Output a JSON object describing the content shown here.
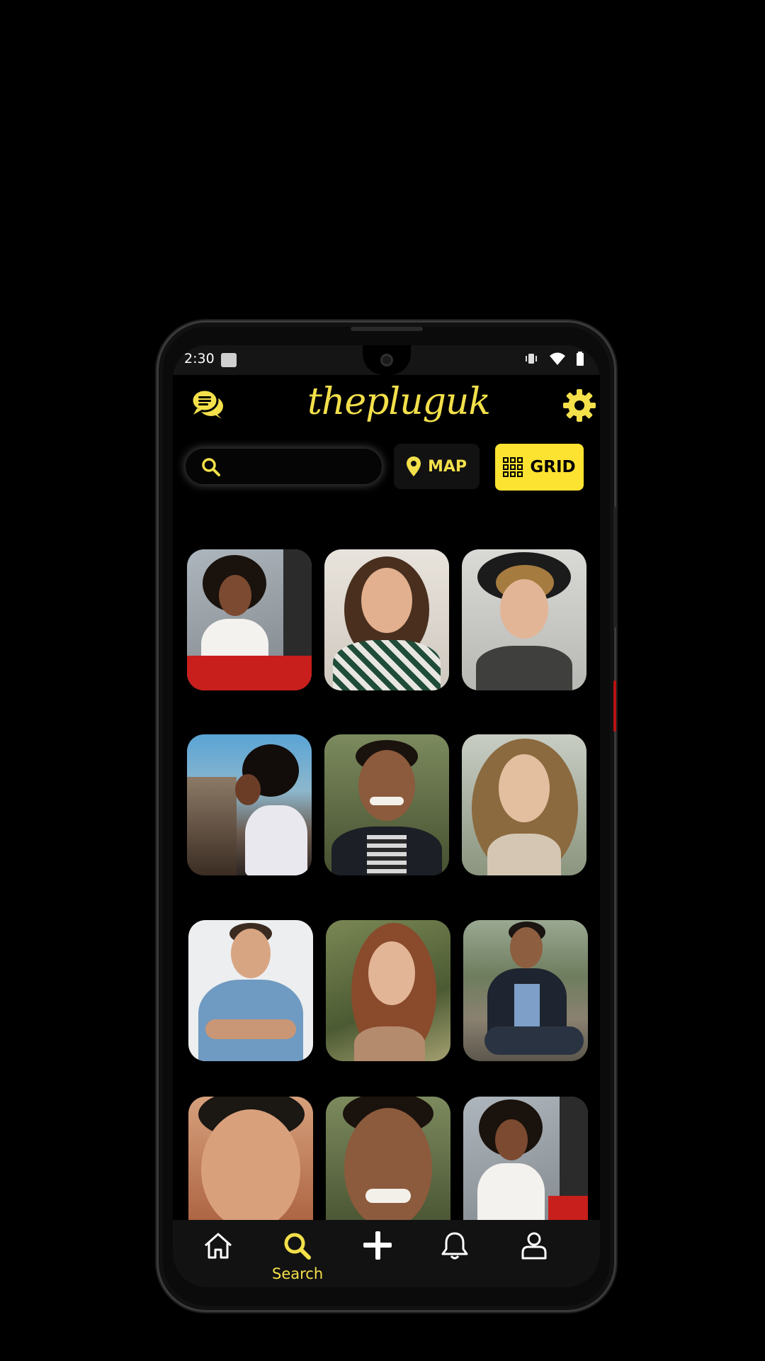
{
  "status_bar": {
    "time": "2:30"
  },
  "header": {
    "logo_text": "thepluguk",
    "chat_icon": "chat-bubbles-icon",
    "settings_icon": "gear-icon"
  },
  "search": {
    "placeholder": "",
    "value": ""
  },
  "view_toggle": {
    "map_label": "MAP",
    "grid_label": "GRID",
    "active": "GRID"
  },
  "profiles": [
    {
      "id": "p1"
    },
    {
      "id": "p2"
    },
    {
      "id": "p3"
    },
    {
      "id": "p4"
    },
    {
      "id": "p5"
    },
    {
      "id": "p6"
    },
    {
      "id": "p7"
    },
    {
      "id": "p8"
    },
    {
      "id": "p9"
    },
    {
      "id": "p10"
    },
    {
      "id": "p11"
    },
    {
      "id": "p12"
    }
  ],
  "bottom_nav": {
    "items": [
      {
        "icon": "home-icon",
        "label": ""
      },
      {
        "icon": "search-icon",
        "label": "Search"
      },
      {
        "icon": "plus-icon",
        "label": ""
      },
      {
        "icon": "bell-icon",
        "label": ""
      },
      {
        "icon": "user-icon",
        "label": ""
      }
    ],
    "active": "Search"
  },
  "colors": {
    "accent": "#fce231",
    "background": "#000000"
  }
}
